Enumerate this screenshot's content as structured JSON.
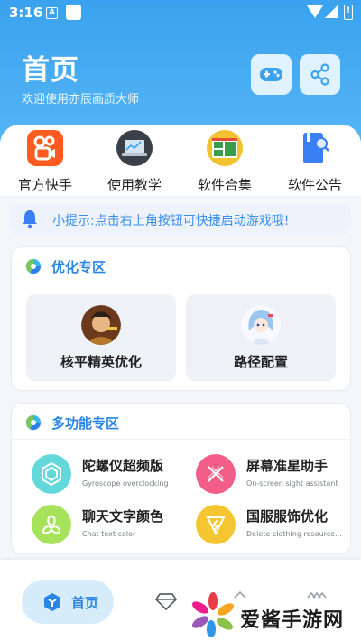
{
  "status": {
    "time": "3:16",
    "a_glyph": "A",
    "battery_glyph": "!"
  },
  "header": {
    "title": "首页",
    "subtitle": "欢迎使用亦辰画质大师",
    "game_icon": "gamepad-icon",
    "share_icon": "share-icon",
    "accent": "#3aa2ee"
  },
  "quick_links": [
    {
      "label": "官方快手",
      "icon": "kuaishou-icon",
      "color": "#ff5a1f"
    },
    {
      "label": "使用教学",
      "icon": "laptop-tutorial-icon",
      "color": "#3a3f48"
    },
    {
      "label": "软件合集",
      "icon": "app-collection-icon",
      "color": "#f2c230"
    },
    {
      "label": "软件公告",
      "icon": "announcement-icon",
      "color": "#3b7ff5"
    }
  ],
  "tip": {
    "text": "小提示:点击右上角按钮可快捷启动游戏哦!",
    "icon": "bell-icon"
  },
  "optimize": {
    "title": "优化专区",
    "items": [
      {
        "label": "核平精英优化",
        "icon": "pubg-character-avatar"
      },
      {
        "label": "路径配置",
        "icon": "anime-girl-avatar"
      }
    ]
  },
  "multi": {
    "title": "多功能专区",
    "items": [
      {
        "name": "陀螺仪超频版",
        "desc": "Gyroscope overclocking",
        "icon": "gyroscope-icon",
        "color": "#62d8da"
      },
      {
        "name": "屏幕准星助手",
        "desc": "On-screen sight assistant",
        "icon": "crosshair-icon",
        "color": "#f25e87"
      },
      {
        "name": "聊天文字颜色",
        "desc": "Chat text color",
        "icon": "chat-color-icon",
        "color": "#a6e35a"
      },
      {
        "name": "国服服饰优化",
        "desc": "Delete clothing resource...",
        "icon": "clothing-icon",
        "color": "#f6c532"
      }
    ]
  },
  "nav": {
    "home_label": "首页",
    "home_icon": "home-cube-icon",
    "gem_icon": "diamond-icon",
    "up_icon": "chevron-up-icon",
    "more_icon": "double-chevron-up-icon"
  },
  "watermark": {
    "text": "爱酱手游网",
    "icon": "pinwheel-logo"
  }
}
